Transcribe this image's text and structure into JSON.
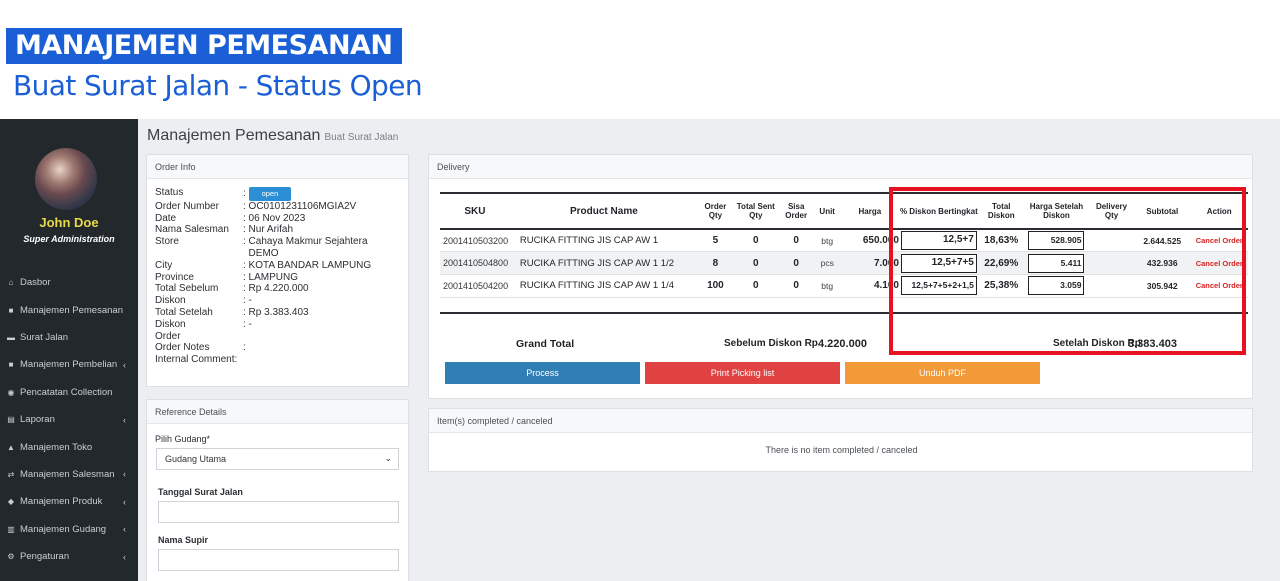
{
  "banner": {
    "title": "MANAJEMEN PEMESANAN",
    "subtitle": "Buat Surat Jalan - Status Open"
  },
  "sidebar": {
    "user_name": "John Doe",
    "user_role": "Super Administration",
    "items": [
      {
        "label": "Dasbor",
        "icon": "home-icon",
        "chevron": ""
      },
      {
        "label": "Manajemen Pemesanan",
        "icon": "cart-icon",
        "chevron": ""
      },
      {
        "label": "Surat Jalan",
        "icon": "truck-icon",
        "chevron": ""
      },
      {
        "label": "Manajemen Pembelian",
        "icon": "cart-icon",
        "chevron": "‹"
      },
      {
        "label": "Pencatatan Collection",
        "icon": "handshake-icon",
        "chevron": ""
      },
      {
        "label": "Laporan",
        "icon": "chart-icon",
        "chevron": "‹"
      },
      {
        "label": "Manajemen Toko",
        "icon": "bank-icon",
        "chevron": ""
      },
      {
        "label": "Manajemen Salesman",
        "icon": "exchange-icon",
        "chevron": "‹"
      },
      {
        "label": "Manajemen Produk",
        "icon": "box-icon",
        "chevron": "‹"
      },
      {
        "label": "Manajemen Gudang",
        "icon": "warehouse-icon",
        "chevron": "‹"
      },
      {
        "label": "Pengaturan",
        "icon": "gears-icon",
        "chevron": "‹"
      }
    ]
  },
  "page": {
    "title": "Manajemen Pemesanan",
    "subtitle": "Buat Surat Jalan"
  },
  "order_info": {
    "header": "Order Info",
    "status_label": "Status",
    "status_value": "open",
    "rows": [
      {
        "k": "Order Number",
        "v": ": OC0101231106MGIA2V"
      },
      {
        "k": "Date",
        "v": ": 06 Nov 2023"
      },
      {
        "k": "Nama Salesman",
        "v": ": Nur Arifah"
      },
      {
        "k": "Store",
        "v": ": Cahaya Makmur Sejahtera"
      },
      {
        "k": "",
        "v": "  DEMO"
      },
      {
        "k": "City",
        "v": ": KOTA BANDAR LAMPUNG"
      },
      {
        "k": "Province",
        "v": ": LAMPUNG"
      },
      {
        "k": "Total Sebelum",
        "v": ": Rp 4.220.000"
      },
      {
        "k": "Diskon",
        "v": ": -"
      },
      {
        "k": "Total Setelah",
        "v": ": Rp 3.383.403"
      },
      {
        "k": "Diskon",
        "v": ": -"
      },
      {
        "k": "Order",
        "v": ""
      },
      {
        "k": "Order Notes",
        "v": ":"
      },
      {
        "k": "Internal Comment:",
        "v": ""
      }
    ]
  },
  "reference": {
    "header": "Reference Details",
    "gudang_label": "Pilih Gudang*",
    "gudang_value": "Gudang Utama",
    "tanggal_label": "Tanggal Surat Jalan",
    "supir_label": "Nama Supir"
  },
  "delivery": {
    "header": "Delivery",
    "columns": [
      "SKU",
      "Product Name",
      "Order Qty",
      "Total Sent Qty",
      "Sisa Order",
      "Unit",
      "Harga",
      "% Diskon Bertingkat",
      "Total Diskon",
      "Harga Setelah Diskon",
      "Delivery Qty",
      "Subtotal",
      "Action"
    ],
    "rows": [
      {
        "sku": "2001410503200",
        "name": "RUCIKA FITTING JIS CAP AW 1",
        "order_qty": "5",
        "sent": "0",
        "sisa": "0",
        "unit": "btg",
        "harga": "650.000",
        "diskon": "12,5+7",
        "total_diskon": "18,63%",
        "harga_setelah": "528.905",
        "subtotal": "2.644.525",
        "action": "Cancel Order"
      },
      {
        "sku": "2001410504800",
        "name": "RUCIKA FITTING JIS CAP AW 1 1/2",
        "order_qty": "8",
        "sent": "0",
        "sisa": "0",
        "unit": "pcs",
        "harga": "7.000",
        "diskon": "12,5+7+5",
        "total_diskon": "22,69%",
        "harga_setelah": "5.411",
        "subtotal": "432.936",
        "action": "Cancel Order"
      },
      {
        "sku": "2001410504200",
        "name": "RUCIKA FITTING JIS CAP AW 1 1/4",
        "order_qty": "100",
        "sent": "0",
        "sisa": "0",
        "unit": "btg",
        "harga": "4.100",
        "diskon": "12,5+7+5+2+1,5",
        "total_diskon": "25,38%",
        "harga_setelah": "3.059",
        "subtotal": "305.942",
        "action": "Cancel Order"
      }
    ],
    "grand_total_label": "Grand Total",
    "sebelum_label": "Sebelum Diskon  Rp",
    "sebelum_value": "4.220.000",
    "setelah_label": "Setelah Diskon Rp",
    "setelah_value": "3.383.403",
    "btn_process": "Process",
    "btn_print": "Print Picking list",
    "btn_pdf": "Unduh PDF"
  },
  "completed": {
    "header": "Item(s) completed / canceled",
    "empty": "There is no item completed / canceled"
  },
  "colors": {
    "accent_blue": "#1a5fd6",
    "process": "#2f7fb5",
    "print": "#e04141",
    "pdf": "#f29a37",
    "highlight": "#e8111f"
  }
}
